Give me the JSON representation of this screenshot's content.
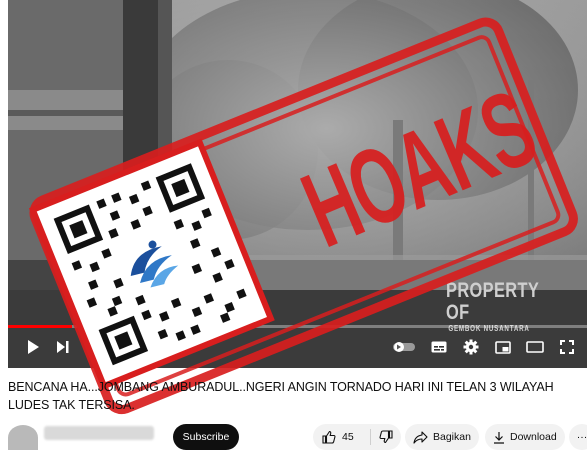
{
  "player": {
    "watermark_line1": "PROPERTY OF",
    "watermark_line2": "GEMBOK NUSANTARA",
    "progress_fraction": 0.11,
    "controls": [
      {
        "name": "play-icon"
      },
      {
        "name": "next-icon"
      },
      {
        "name": "autoplay-toggle-icon"
      },
      {
        "name": "subtitles-icon"
      },
      {
        "name": "settings-gear-icon"
      },
      {
        "name": "miniplayer-icon"
      },
      {
        "name": "theater-mode-icon"
      },
      {
        "name": "fullscreen-icon"
      }
    ]
  },
  "stamp": {
    "text": "HOAKS",
    "color": "#d81e1e",
    "qr_logo": "komdigi-logo"
  },
  "video": {
    "title": "BENCANA HA...JOMBANG AMBURADUL..NGERI ANGIN TORNADO HARI INI TELAN 3 WILAYAH LUDES TAK TERSISA."
  },
  "actions": {
    "subscribe_label": "Subscribe",
    "like_count": "45",
    "share_label": "Bagikan",
    "download_label": "Download",
    "more_label": "···"
  },
  "colors": {
    "accent_red": "#ff0000",
    "subscribe_bg": "#0f0f0f",
    "pill_bg": "#f2f2f2"
  }
}
